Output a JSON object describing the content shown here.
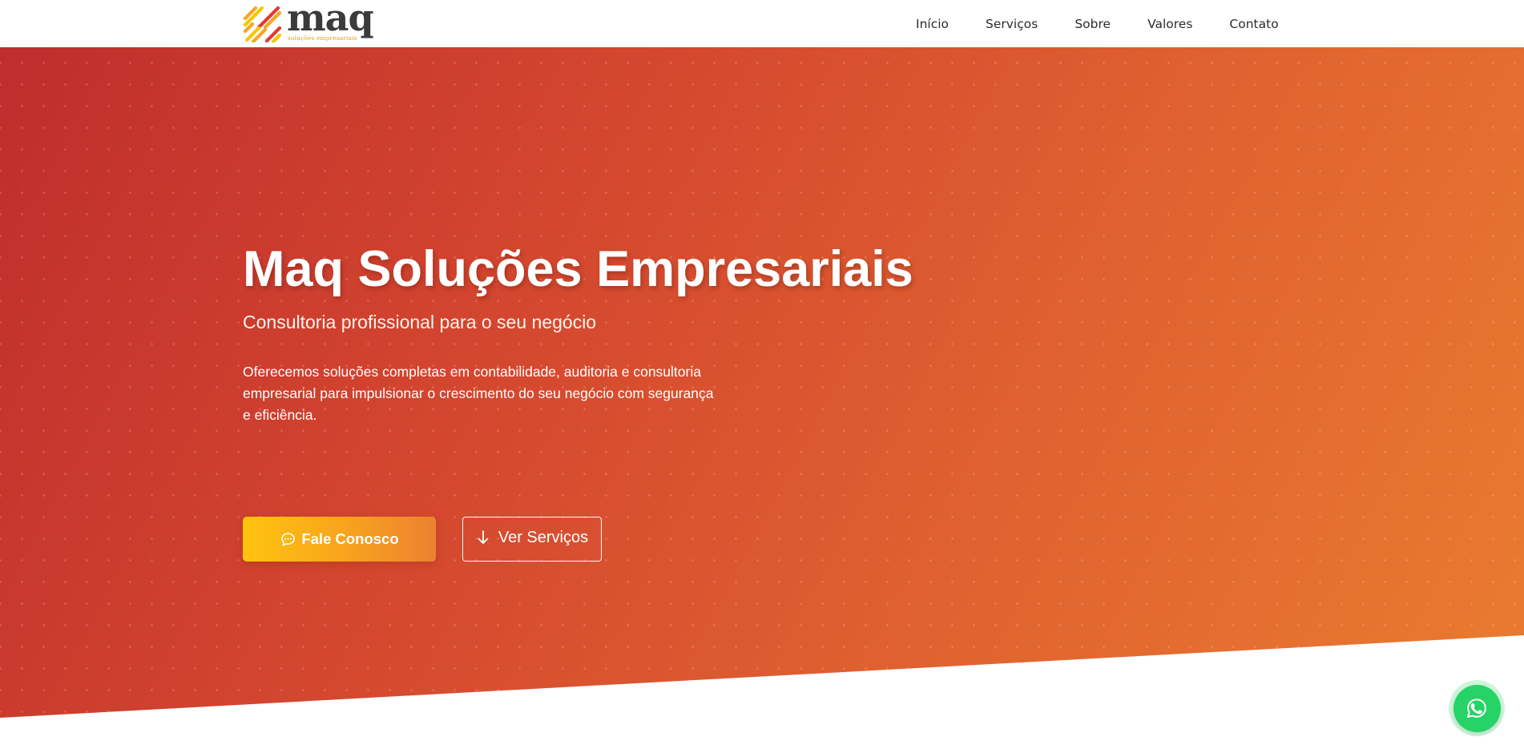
{
  "header": {
    "logo": {
      "wordmark": "maq",
      "tagline": "soluções empresariais",
      "icon": "logo-mark-icon",
      "colors": [
        "#e53935",
        "#f5a623",
        "#f7c600"
      ]
    },
    "nav": [
      {
        "label": "Início"
      },
      {
        "label": "Serviços"
      },
      {
        "label": "Sobre"
      },
      {
        "label": "Valores"
      },
      {
        "label": "Contato"
      }
    ]
  },
  "hero": {
    "title": "Maq Soluções Empresariais",
    "subtitle": "Consultoria profissional para o seu negócio",
    "description": "Oferecemos soluções completas em contabilidade, auditoria e consultoria empresarial para impulsionar o crescimento do seu negócio com segurança e eficiência.",
    "primary_button": {
      "label": "Fale Conosco",
      "icon": "chat-bubble-icon"
    },
    "secondary_button": {
      "label": "Ver Serviços",
      "icon": "arrow-down-icon"
    },
    "background_colors": [
      "#bf2d2d",
      "#ea7b30"
    ]
  },
  "whatsapp": {
    "icon": "whatsapp-icon",
    "color": "#25d366"
  }
}
